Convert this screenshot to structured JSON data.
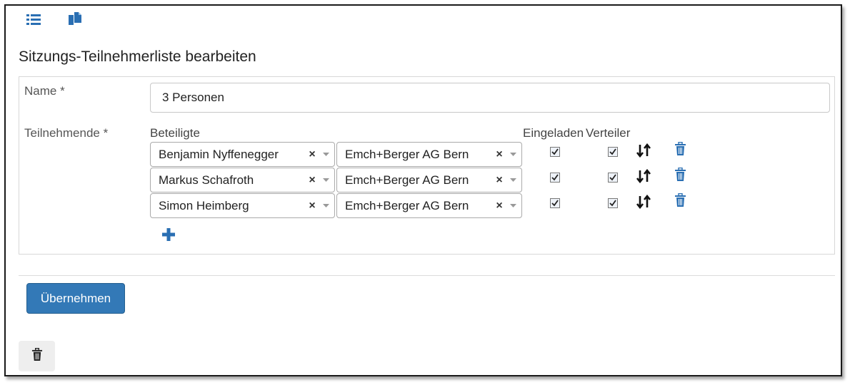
{
  "toolbar": {
    "icons": [
      "list-icon",
      "copy-icon"
    ]
  },
  "page": {
    "title": "Sitzungs-Teilnehmerliste bearbeiten"
  },
  "form": {
    "name_label": "Name *",
    "name_value": "3 Personen",
    "participants_label": "Teilnehmende *",
    "columns": {
      "beteiligte": "Beteiligte",
      "eingeladen": "Eingeladen",
      "verteiler": "Verteiler"
    },
    "participants": [
      {
        "person": "Benjamin Nyffenegger",
        "organization": "Emch+Berger AG Bern",
        "eingeladen": true,
        "verteiler": true
      },
      {
        "person": "Markus Schafroth",
        "organization": "Emch+Berger AG Bern",
        "eingeladen": true,
        "verteiler": true
      },
      {
        "person": "Simon Heimberg",
        "organization": "Emch+Berger AG Bern",
        "eingeladen": true,
        "verteiler": true
      }
    ],
    "clear_symbol": "×"
  },
  "actions": {
    "submit_label": "Übernehmen"
  },
  "colors": {
    "primary": "#3379b7",
    "icon_blue": "#2a6fb3"
  }
}
